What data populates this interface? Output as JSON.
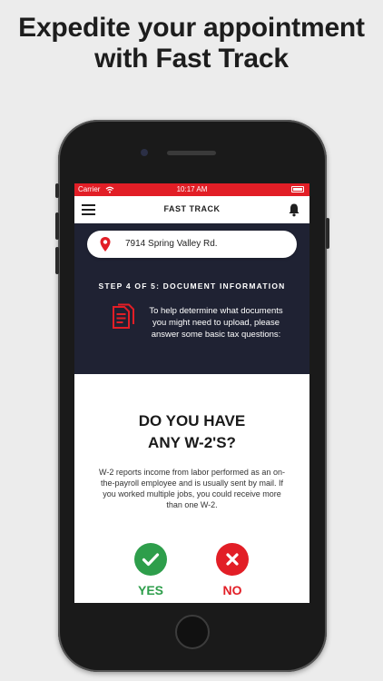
{
  "headline": {
    "line1": "Expedite your appointment",
    "line2": "with Fast Track"
  },
  "statusbar": {
    "carrier": "Carrier",
    "time": "10:17 AM"
  },
  "navbar": {
    "title": "FAST TRACK"
  },
  "address": {
    "value": "7914 Spring Valley Rd."
  },
  "step": {
    "label": "STEP 4 OF 5: DOCUMENT INFORMATION"
  },
  "help": {
    "text": "To help determine what documents you might need to upload, please answer some basic tax questions:"
  },
  "question": {
    "line1": "DO YOU HAVE",
    "line2": "ANY W-2'S?"
  },
  "description": {
    "text": "W-2 reports income from labor performed as an on-the-payroll employee and is usually sent by mail. If you worked multiple jobs, you could receive more than one W-2."
  },
  "answers": {
    "yes": "YES",
    "no": "NO"
  },
  "colors": {
    "accent_red": "#e21e26",
    "yes_green": "#2e9e4b",
    "dark_panel": "#1f2233"
  },
  "icons": {
    "menu": "hamburger-icon",
    "bell": "bell-icon",
    "pin": "map-pin-icon",
    "doc": "documents-icon",
    "check": "check-icon",
    "x": "close-icon",
    "wifi": "wifi-icon",
    "battery": "battery-icon"
  }
}
